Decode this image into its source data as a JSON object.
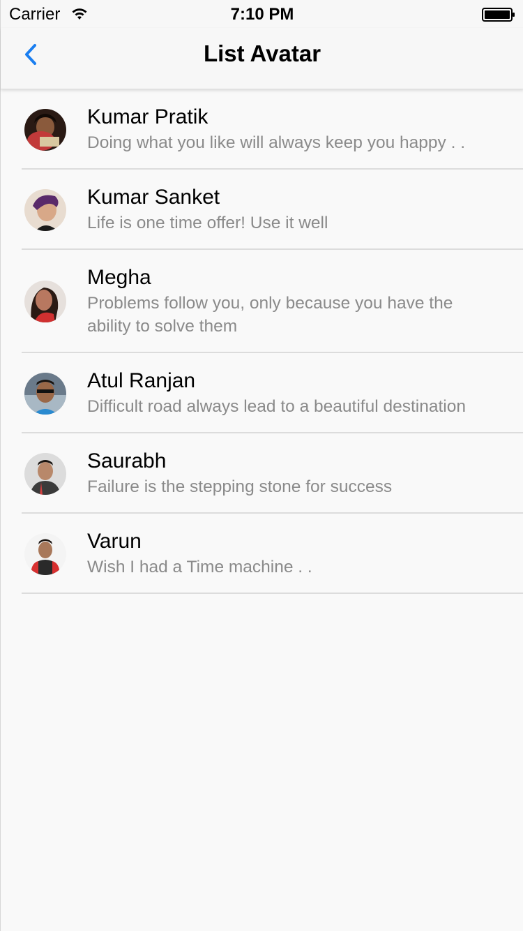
{
  "status_bar": {
    "carrier": "Carrier",
    "time": "7:10 PM"
  },
  "nav": {
    "title": "List Avatar",
    "back_icon": "chevron-left-icon",
    "accent_color": "#1a7ef0"
  },
  "list": [
    {
      "name": "Kumar Pratik",
      "description": "Doing what you like will always keep you happy . ."
    },
    {
      "name": "Kumar Sanket",
      "description": "Life is one time offer! Use it well"
    },
    {
      "name": "Megha",
      "description": "Problems follow you, only because you have the ability to solve them"
    },
    {
      "name": "Atul Ranjan",
      "description": "Difficult road always lead to a beautiful destination"
    },
    {
      "name": "Saurabh",
      "description": "Failure is the stepping stone for success"
    },
    {
      "name": "Varun",
      "description": "Wish I had a Time machine . ."
    }
  ]
}
